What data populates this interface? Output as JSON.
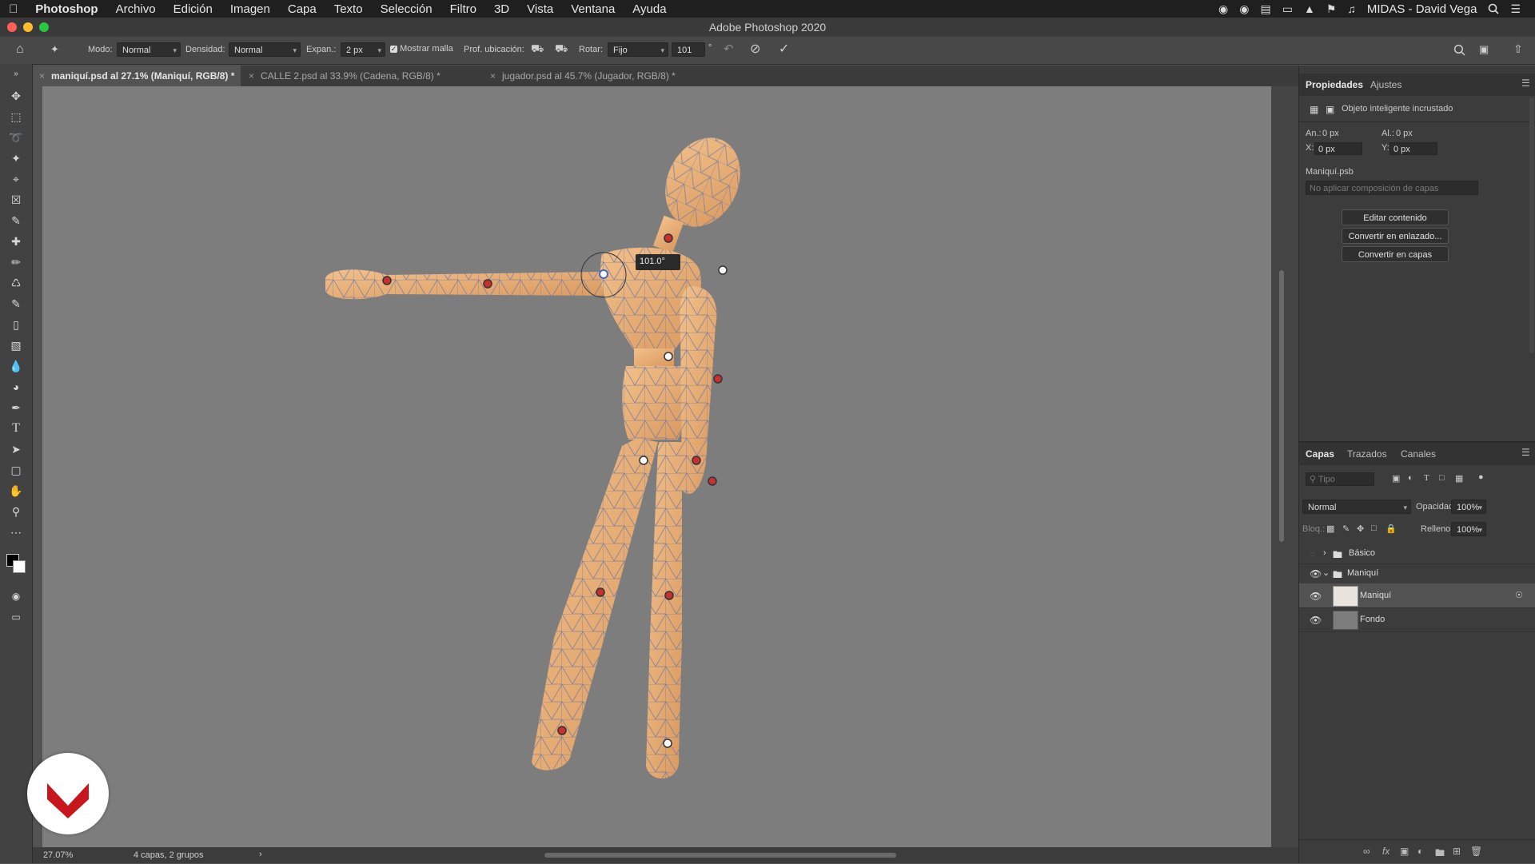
{
  "menubar": {
    "app": "Photoshop",
    "items": [
      "Archivo",
      "Edición",
      "Imagen",
      "Capa",
      "Texto",
      "Selección",
      "Filtro",
      "3D",
      "Vista",
      "Ventana",
      "Ayuda"
    ],
    "user": "MIDAS - David Vega"
  },
  "window": {
    "title": "Adobe Photoshop 2020"
  },
  "options": {
    "mode_label": "Modo:",
    "mode_value": "Normal",
    "density_label": "Densidad:",
    "density_value": "Normal",
    "expand_label": "Expan.:",
    "expand_value": "2 px",
    "show_mesh_label": "Mostrar malla",
    "depth_label": "Prof. ubicación:",
    "rotate_label": "Rotar:",
    "rotate_value": "Fijo",
    "rotate_degrees": "101",
    "degree_symbol": "°"
  },
  "tabs": [
    {
      "label": "maniquí.psd al 27.1% (Maniquí, RGB/8) *",
      "active": true
    },
    {
      "label": "CALLE 2.psd al 33.9% (Cadena, RGB/8) *",
      "active": false
    },
    {
      "label": "jugador.psd al 45.7% (Jugador, RGB/8) *",
      "active": false
    }
  ],
  "canvas": {
    "angle_readout": "101.0°"
  },
  "status": {
    "zoom": "27.07%",
    "info": "4 capas, 2 grupos"
  },
  "properties": {
    "tab_properties": "Propiedades",
    "tab_adjust": "Ajustes",
    "smart_object": "Objeto inteligente incrustado",
    "w_label": "An.:",
    "w_value": "0 px",
    "h_label": "Al.:",
    "h_value": "0 px",
    "x_label": "X:",
    "x_value": "0 px",
    "y_label": "Y:",
    "y_value": "0 px",
    "file": "Maniquí.psb",
    "comp_placeholder": "No aplicar composición de capas",
    "btn_edit": "Editar contenido",
    "btn_linked": "Convertir en enlazado...",
    "btn_layers": "Convertir en capas"
  },
  "layers_panel": {
    "tab_layers": "Capas",
    "tab_paths": "Trazados",
    "tab_channels": "Canales",
    "search_placeholder": "Tipo",
    "blend_mode": "Normal",
    "opacity_label": "Opacidad:",
    "opacity_value": "100%",
    "lock_label": "Bloq.:",
    "fill_label": "Relleno:",
    "fill_value": "100%",
    "layers": [
      {
        "name": "Básico",
        "kind": "group",
        "visible": false,
        "expanded": false
      },
      {
        "name": "Maniquí",
        "kind": "group",
        "visible": true,
        "expanded": true
      },
      {
        "name": "Maniquí",
        "kind": "smart-object",
        "visible": true,
        "selected": true
      },
      {
        "name": "Fondo",
        "kind": "layer",
        "visible": true
      }
    ]
  },
  "colors": {
    "accent_logo": "#c8161d",
    "mannequin": "#e8b07a",
    "mesh": "#6a78a8"
  }
}
